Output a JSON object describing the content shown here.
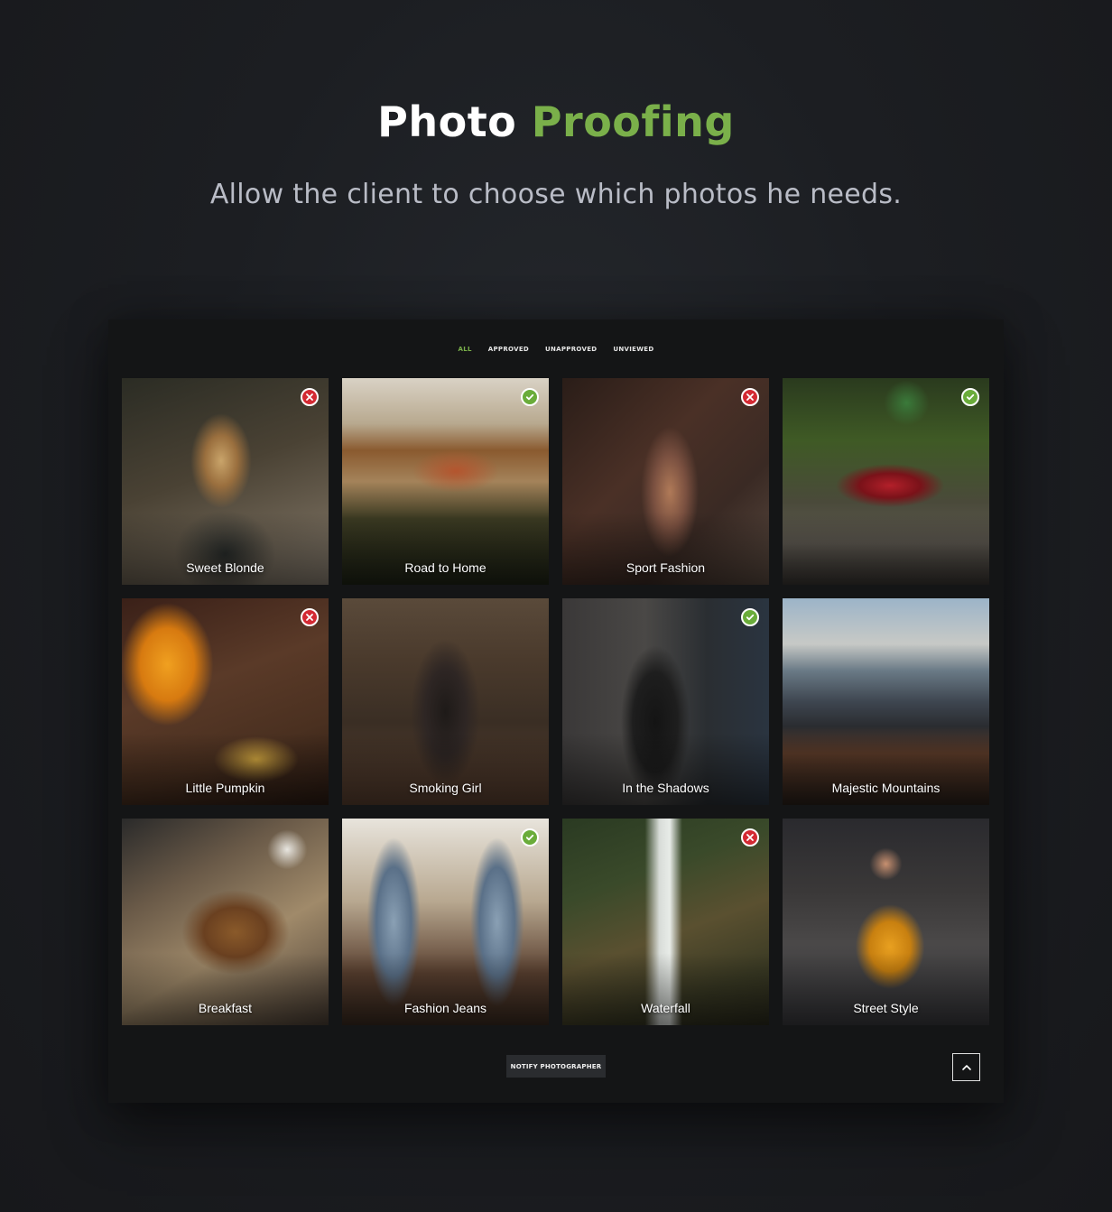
{
  "header": {
    "title_part1": "Photo",
    "title_part2": "Proofing",
    "subtitle": "Allow the client to choose which photos he needs."
  },
  "colors": {
    "accent": "#7ab04a",
    "approved": "#6aac3a",
    "rejected": "#d32a33"
  },
  "filters": [
    {
      "label": "ALL",
      "active": true
    },
    {
      "label": "APPROVED",
      "active": false
    },
    {
      "label": "UNAPPROVED",
      "active": false
    },
    {
      "label": "UNVIEWED",
      "active": false
    }
  ],
  "photos": [
    {
      "caption": "Sweet Blonde",
      "status": "rejected",
      "status_icon": "x-icon"
    },
    {
      "caption": "Road to Home",
      "status": "approved",
      "status_icon": "check-icon"
    },
    {
      "caption": "Sport Fashion",
      "status": "rejected",
      "status_icon": "x-icon"
    },
    {
      "caption": "",
      "status": "approved",
      "status_icon": "check-icon"
    },
    {
      "caption": "Little Pumpkin",
      "status": "rejected",
      "status_icon": "x-icon"
    },
    {
      "caption": "Smoking Girl",
      "status": "none",
      "status_icon": ""
    },
    {
      "caption": "In the Shadows",
      "status": "approved",
      "status_icon": "check-icon"
    },
    {
      "caption": "Majestic Mountains",
      "status": "none",
      "status_icon": ""
    },
    {
      "caption": "Breakfast",
      "status": "none",
      "status_icon": ""
    },
    {
      "caption": "Fashion Jeans",
      "status": "approved",
      "status_icon": "check-icon"
    },
    {
      "caption": "Waterfall",
      "status": "rejected",
      "status_icon": "x-icon"
    },
    {
      "caption": "Street Style",
      "status": "none",
      "status_icon": ""
    }
  ],
  "footer": {
    "notify_label": "NOTIFY PHOTOGRAPHER",
    "top_icon": "chevron-up-icon"
  }
}
